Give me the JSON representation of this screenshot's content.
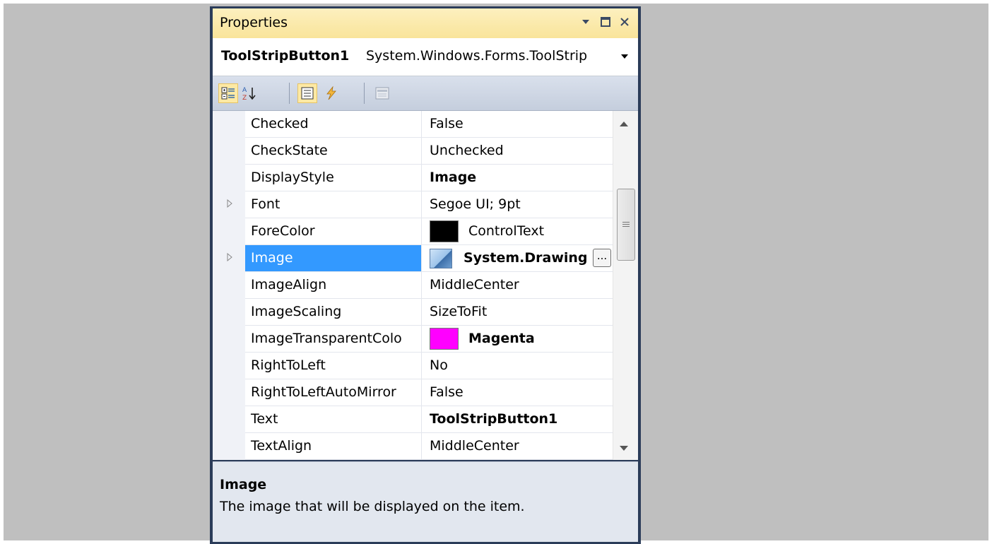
{
  "window": {
    "title": "Properties",
    "controls": [
      "dropdown-arrow",
      "maximize",
      "close"
    ]
  },
  "object_selector": {
    "name": "ToolStripButton1",
    "type": "System.Windows.Forms.ToolStrip",
    "dropdown_icon": "chevron-down-icon"
  },
  "toolbar": {
    "buttons": [
      {
        "name": "categorized-icon",
        "active": true
      },
      {
        "name": "alphabetical-icon",
        "active": false
      },
      {
        "name": "properties-icon",
        "active": true
      },
      {
        "name": "events-icon",
        "active": false
      },
      {
        "name": "property-pages-icon",
        "active": false
      }
    ]
  },
  "properties": [
    {
      "name": "Checked",
      "value": "False"
    },
    {
      "name": "CheckState",
      "value": "Unchecked"
    },
    {
      "name": "DisplayStyle",
      "value": "Image",
      "bold": true
    },
    {
      "name": "Font",
      "value": "Segoe UI; 9pt",
      "expandable": true
    },
    {
      "name": "ForeColor",
      "value": "ControlText",
      "swatch": "#000000"
    },
    {
      "name": "Image",
      "value": "System.Drawing",
      "bold": true,
      "expandable": true,
      "selected": true,
      "has_image_icon": true,
      "ellipsis": "..."
    },
    {
      "name": "ImageAlign",
      "value": "MiddleCenter"
    },
    {
      "name": "ImageScaling",
      "value": "SizeToFit"
    },
    {
      "name": "ImageTransparentColo",
      "value": "Magenta",
      "bold": true,
      "swatch": "#ff00ff"
    },
    {
      "name": "RightToLeft",
      "value": "No"
    },
    {
      "name": "RightToLeftAutoMirror",
      "value": "False"
    },
    {
      "name": "Text",
      "value": "ToolStripButton1",
      "bold": true
    },
    {
      "name": "TextAlign",
      "value": "MiddleCenter"
    }
  ],
  "description": {
    "title": "Image",
    "text": "The image that will be displayed on the item."
  },
  "colors": {
    "selection": "#3399ff",
    "title_bar": "#f9e49a",
    "frame": "#2b3c59"
  }
}
